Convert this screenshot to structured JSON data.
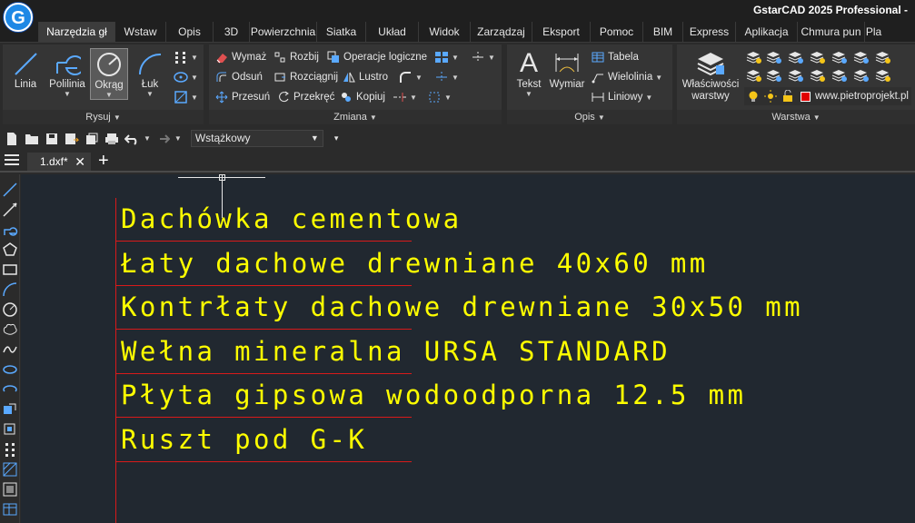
{
  "app": {
    "title": "GstarCAD 2025 Professional -",
    "logo_letter": "G"
  },
  "ribbon_tabs": [
    {
      "label": "Narzędzia gł",
      "active": true
    },
    {
      "label": "Wstaw"
    },
    {
      "label": "Opis"
    },
    {
      "label": "3D"
    },
    {
      "label": "Powierzchnia"
    },
    {
      "label": "Siatka"
    },
    {
      "label": "Układ"
    },
    {
      "label": "Widok"
    },
    {
      "label": "Zarządzaj"
    },
    {
      "label": "Eksport"
    },
    {
      "label": "Pomoc"
    },
    {
      "label": "BIM"
    },
    {
      "label": "Express"
    },
    {
      "label": "Aplikacja"
    },
    {
      "label": "Chmura pun"
    },
    {
      "label": "Pla"
    }
  ],
  "ribbon": {
    "draw": {
      "label": "Rysuj",
      "line": "Linia",
      "polyline": "Polilinia",
      "circle": "Okrąg",
      "arc": "Łuk"
    },
    "modify": {
      "label": "Zmiana",
      "erase": "Wymaż",
      "explode": "Rozbij",
      "boolean": "Operacje logiczne",
      "offset": "Odsuń",
      "stretch": "Rozciągnij",
      "mirror": "Lustro",
      "move": "Przesuń",
      "rotate": "Przekręć",
      "copy": "Kopiuj"
    },
    "annotation": {
      "label": "Opis",
      "text": "Tekst",
      "dimension": "Wymiar",
      "table": "Tabela",
      "multileader": "Wielolinia",
      "linear": "Liniowy"
    },
    "layers": {
      "label": "Warstwa",
      "properties": "Właściwości warstwy",
      "current_layer": "www.pietroprojekt.pl",
      "current_color": "#e00000"
    }
  },
  "quick_access": {
    "workspace": "Wstążkowy"
  },
  "document": {
    "tab": "1.dxf*",
    "add": "+"
  },
  "drawing": {
    "text_color": "#ffff00",
    "line_color": "#d91a1a",
    "lines": [
      "Dachówka cementowa",
      "Łaty dachowe drewniane 40x60 mm",
      "Kontrłaty dachowe drewniane 30x50 mm",
      "Wełna mineralna URSA STANDARD",
      "Płyta gipsowa wodoodporna 12.5 mm",
      "Ruszt pod G-K"
    ]
  }
}
